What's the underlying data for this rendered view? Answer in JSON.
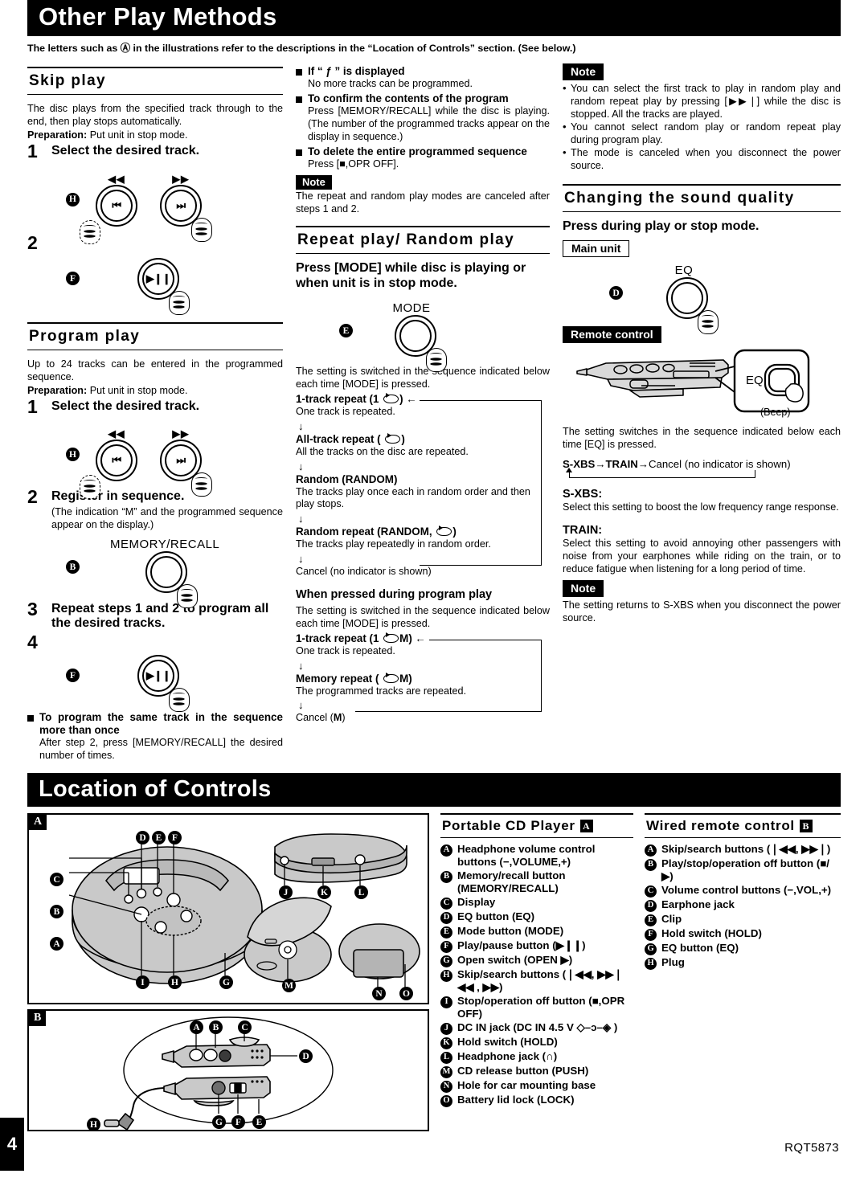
{
  "page": {
    "number": "4",
    "doc_code": "RQT5873"
  },
  "header": {
    "title": "Other Play Methods",
    "intro": "The letters such as Ⓐ in the illustrations refer to the descriptions in the “Location of Controls” section. (See below.)"
  },
  "skip_play": {
    "title": "Skip play",
    "body": "The disc plays from the specified track through to the end, then play stops automatically.",
    "preparation_label": "Preparation:",
    "preparation_text": "Put unit in stop mode.",
    "step1_num": "1",
    "step1_text": "Select the desired track.",
    "step2_num": "2",
    "ref_h": "H",
    "ref_f": "F",
    "btn_rev_label": "◀◀",
    "btn_fwd_label": "▶▶",
    "btn_prev_glyph": "⏮",
    "btn_next_glyph": "⏭",
    "btn_play_glyph": "▶❙❙"
  },
  "program_play": {
    "title": "Program play",
    "body": "Up to 24 tracks can be entered in the programmed sequence.",
    "preparation_label": "Preparation:",
    "preparation_text": "Put unit in stop mode.",
    "step1_num": "1",
    "step1_text": "Select the desired track.",
    "step2_num": "2",
    "step2_text": "Register in sequence.",
    "step2_sub": "(The indication “M” and the programmed sequence appear on the display.)",
    "memory_recall_label": "MEMORY/RECALL",
    "step3_num": "3",
    "step3_text": "Repeat steps 1 and 2 to program all the desired tracks.",
    "step4_num": "4",
    "ref_h": "H",
    "ref_b": "B",
    "ref_f": "F",
    "same_track_head": "To program the same track in the sequence more than once",
    "same_track_body": "After step 2, press [MEMORY/RECALL] the desired number of times."
  },
  "program_notes": {
    "if_full_head": "If “ ƒ ” is displayed",
    "if_full_body": "No more tracks can be programmed.",
    "confirm_head": "To confirm the contents of the program",
    "confirm_body": "Press [MEMORY/RECALL] while the disc is playing. (The number of the programmed tracks appear on the display in sequence.)",
    "delete_head": "To delete the entire programmed sequence",
    "delete_body": "Press [■,OPR OFF].",
    "note_tag": "Note",
    "note_body": "The repeat and random play modes are canceled after steps 1 and 2."
  },
  "repeat_random": {
    "title": "Repeat play/ Random play",
    "lead": "Press [MODE] while disc is playing or when unit is in stop mode.",
    "mode_label": "MODE",
    "ref_e": "E",
    "seq_intro": "The setting is switched in the sequence indicated below each time [MODE] is pressed.",
    "items": [
      {
        "head_pre": "1-track repeat (1",
        "head_post": ")",
        "body": "One track is repeated."
      },
      {
        "head_pre": "All-track repeat (",
        "head_post": ")",
        "body": "All the tracks on the disc are repeated."
      },
      {
        "head_pre": "Random (RANDOM)",
        "head_post": "",
        "body": "The tracks play once each in random order and then play stops."
      },
      {
        "head_pre": "Random repeat (RANDOM,",
        "head_post": ")",
        "body": "The tracks play repeatedly in random order."
      }
    ],
    "cancel": "Cancel (no indicator is shown)",
    "program_head": "When pressed during program play",
    "program_intro": "The setting is switched in the sequence indicated below each time [MODE] is pressed.",
    "program_items": [
      {
        "head_pre": "1-track repeat (1",
        "head_post": "M)",
        "body": "One track is repeated."
      },
      {
        "head_pre": "Memory repeat (",
        "head_post": "M)",
        "body": "The programmed tracks are repeated."
      }
    ],
    "program_cancel_pre": "Cancel (",
    "program_cancel_bold": "M",
    "program_cancel_post": ")"
  },
  "random_notes": {
    "note_tag": "Note",
    "items": [
      "You can select the first track to play in random play and random repeat play by pressing [▶▶❘] while the disc is stopped. All the tracks are played.",
      "You cannot select random play or random repeat play during program play.",
      "The mode is canceled when you disconnect the power source."
    ]
  },
  "sound_quality": {
    "title": "Changing the sound quality",
    "lead": "Press during play or stop mode.",
    "main_unit_tag": "Main unit",
    "eq_label": "EQ",
    "ref_d": "D",
    "remote_tag": "Remote control",
    "beep_label": "(Beep)",
    "remote_eq_label": "EQ",
    "seq_intro": "The setting switches in the sequence indicated below each time [EQ] is pressed.",
    "seq_a": "S-XBS",
    "seq_arrow1": "→",
    "seq_b": "TRAIN",
    "seq_arrow2": "→",
    "seq_c": "Cancel (no indicator is shown)",
    "sxbs_head": "S-XBS:",
    "sxbs_body": "Select this setting to boost the low frequency range response.",
    "train_head": "TRAIN:",
    "train_body": "Select this setting to avoid annoying other passengers with noise from your earphones while riding on the train, or to reduce fatigue when listening for a long period of time.",
    "note_tag": "Note",
    "note_body": "The setting returns to S-XBS when you disconnect the power source."
  },
  "location_of_controls": {
    "title": "Location of Controls",
    "illus_a_tag": "A",
    "illus_b_tag": "B",
    "illus_a_callouts": [
      "A",
      "B",
      "C",
      "D",
      "E",
      "F",
      "G",
      "H",
      "I",
      "J",
      "K",
      "L",
      "M",
      "N",
      "O"
    ],
    "illus_b_callouts": [
      "A",
      "B",
      "C",
      "D",
      "E",
      "F",
      "G",
      "H"
    ],
    "player": {
      "heading": "Portable CD Player",
      "heading_tag": "A",
      "items": [
        {
          "key": "A",
          "text": "Headphone volume control buttons (−,VOLUME,+)"
        },
        {
          "key": "B",
          "text": "Memory/recall button (MEMORY/RECALL)"
        },
        {
          "key": "C",
          "text": "Display"
        },
        {
          "key": "D",
          "text": "EQ button (EQ)"
        },
        {
          "key": "E",
          "text": "Mode button (MODE)"
        },
        {
          "key": "F",
          "text": "Play/pause button (▶❙❙)"
        },
        {
          "key": "G",
          "text": "Open switch (OPEN ▶)"
        },
        {
          "key": "H",
          "text": "Skip/search buttons (❘◀◀, ▶▶❘  ◀◀ , ▶▶)"
        },
        {
          "key": "I",
          "text": "Stop/operation off button (■,OPR OFF)"
        },
        {
          "key": "J",
          "text": "DC IN jack (DC IN 4.5 V  ◇–ɔ–◈ )"
        },
        {
          "key": "K",
          "text": "Hold switch (HOLD)"
        },
        {
          "key": "L",
          "text": "Headphone jack (∩)"
        },
        {
          "key": "M",
          "text": "CD release button (PUSH)"
        },
        {
          "key": "N",
          "text": "Hole for car mounting base"
        },
        {
          "key": "O",
          "text": "Battery lid lock (LOCK)"
        }
      ]
    },
    "remote": {
      "heading": "Wired remote control",
      "heading_tag": "B",
      "items": [
        {
          "key": "A",
          "text": "Skip/search buttons (❘◀◀, ▶▶❘)"
        },
        {
          "key": "B",
          "text": "Play/stop/operation off button (■/▶)"
        },
        {
          "key": "C",
          "text": "Volume control buttons (−,VOL,+)"
        },
        {
          "key": "D",
          "text": "Earphone jack"
        },
        {
          "key": "E",
          "text": "Clip"
        },
        {
          "key": "F",
          "text": "Hold switch (HOLD)"
        },
        {
          "key": "G",
          "text": "EQ button (EQ)"
        },
        {
          "key": "H",
          "text": "Plug"
        }
      ]
    }
  }
}
